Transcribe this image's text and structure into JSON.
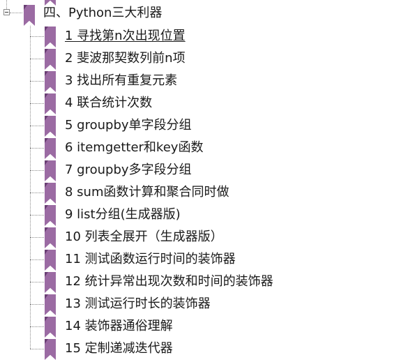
{
  "tree": {
    "root": {
      "label": "四、Python三大利器",
      "expanded": true,
      "icon": "bookmark-icon",
      "icon_color": "#9b6ba3"
    },
    "items": [
      {
        "label": "1 寻找第n次出现位置",
        "selected": true
      },
      {
        "label": "2 斐波那契数列前n项"
      },
      {
        "label": "3 找出所有重复元素"
      },
      {
        "label": "4 联合统计次数"
      },
      {
        "label": "5 groupby单字段分组"
      },
      {
        "label": "6 itemgetter和key函数"
      },
      {
        "label": "7 groupby多字段分组"
      },
      {
        "label": "8 sum函数计算和聚合同时做"
      },
      {
        "label": "9 list分组(生成器版)"
      },
      {
        "label": "10 列表全展开（生成器版）"
      },
      {
        "label": "11 测试函数运行时间的装饰器"
      },
      {
        "label": "12 统计异常出现次数和时间的装饰器"
      },
      {
        "label": "13 测试运行时长的装饰器"
      },
      {
        "label": "14 装饰器通俗理解"
      },
      {
        "label": "15 定制递减迭代器"
      }
    ]
  }
}
